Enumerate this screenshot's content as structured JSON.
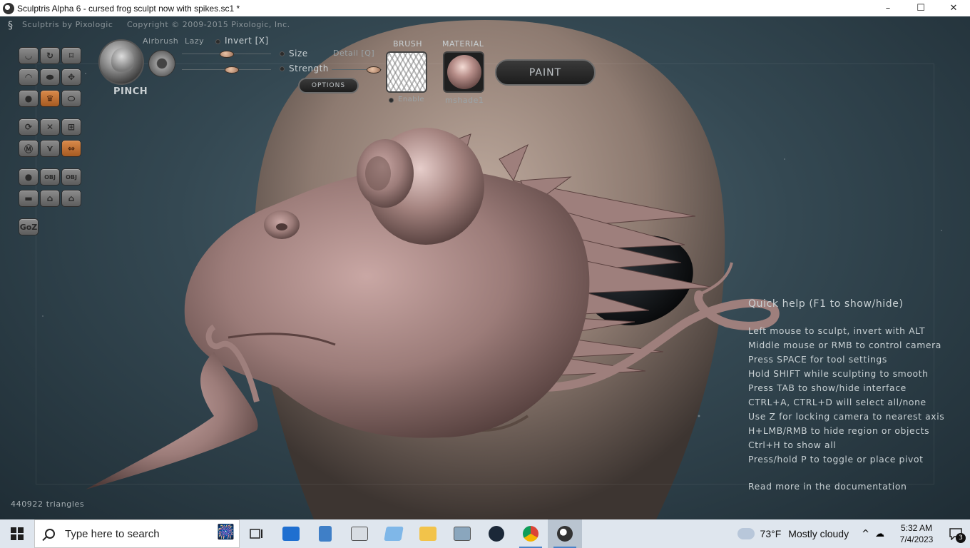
{
  "window": {
    "title": "Sculptris Alpha 6 - cursed frog sculpt now with spikes.sc1 *",
    "min": "–",
    "max": "☐",
    "close": "✕"
  },
  "header": {
    "app_name": "Sculptris by Pixologic",
    "copyright": "Copyright © 2009-2015 Pixologic, Inc."
  },
  "brush": {
    "name": "PINCH",
    "airbrush": "Airbrush",
    "lazy": "Lazy",
    "invert": "Invert [X]",
    "size": "Size",
    "strength": "Strength",
    "detail": "Detail [Q]",
    "options": "OPTIONS",
    "brush_header": "BRUSH",
    "material_header": "MATERIAL",
    "enable": "Enable",
    "material_name": "mshade1",
    "paint": "PAINT"
  },
  "toolbar": {
    "obj1": "OBJ",
    "obj2": "OBJ",
    "goz": "GoZ"
  },
  "help": {
    "title": "Quick help (F1 to show/hide)",
    "lines": [
      "Left mouse to sculpt, invert with ALT",
      "Middle mouse or RMB to control camera",
      "Press SPACE for tool settings",
      "Hold SHIFT while sculpting to smooth",
      "Press TAB to show/hide interface",
      "CTRL+A, CTRL+D will select all/none",
      "Use Z for locking camera to nearest axis",
      "H+LMB/RMB to hide region or objects",
      "Ctrl+H to show all",
      "Press/hold P to toggle or place pivot"
    ],
    "doc_link": "Read more in the documentation"
  },
  "status": {
    "triangles": "440922 triangles"
  },
  "taskbar": {
    "search_placeholder": "Type here to search",
    "weather_temp": "73°F",
    "weather_desc": "Mostly cloudy",
    "time": "5:32 AM",
    "date": "7/4/2023",
    "notifications": "3"
  },
  "colors": {
    "sculpt_material": "#9e7f7c",
    "active_tool": "#c8753a",
    "taskbar": "#dfe6ee"
  }
}
